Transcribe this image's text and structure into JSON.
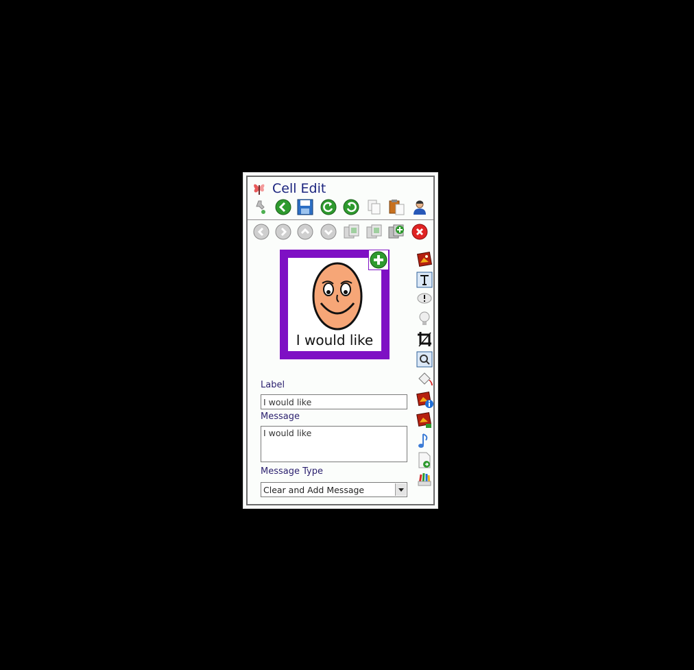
{
  "window": {
    "title": "Cell Edit"
  },
  "toolbar_top": {
    "icons": [
      "wrench-icon",
      "back-icon",
      "save-icon",
      "undo-icon",
      "redo-icon",
      "copy-icon",
      "paste-icon",
      "user-icon"
    ]
  },
  "toolbar_nav": {
    "icons": [
      "nav-left-icon",
      "nav-right-icon",
      "nav-up-icon",
      "nav-down-icon",
      "cells-icon",
      "cells-copy-icon",
      "cells-add-icon",
      "close-icon"
    ]
  },
  "cell": {
    "label": "I would like",
    "border_color": "#7e10c4"
  },
  "form": {
    "label_title": "Label",
    "label_value": "I would like",
    "message_title": "Message",
    "message_value": "I would like",
    "message_type_title": "Message Type",
    "message_type_value": "Clear and Add Message"
  },
  "side_tools": {
    "icons": [
      "image-icon",
      "text-icon",
      "speech-bubble-icon",
      "lightbulb-icon",
      "crop-icon",
      "image-search-icon",
      "fill-icon",
      "image-info-icon",
      "image-swap-icon",
      "music-note-icon",
      "document-icon",
      "color-pencils-icon"
    ]
  }
}
